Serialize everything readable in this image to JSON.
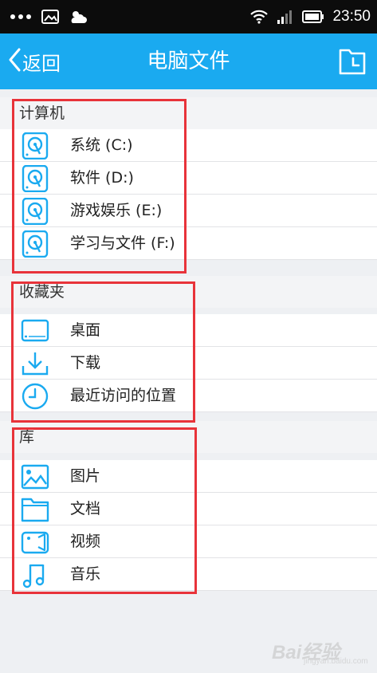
{
  "status_bar": {
    "time": "23:50",
    "icons": [
      "more-dots-icon",
      "image-icon",
      "weather-icon",
      "wifi-icon",
      "signal-icon",
      "battery-icon"
    ]
  },
  "header": {
    "back_label": "返回",
    "title": "电脑文件",
    "accent_color": "#1aaaf0"
  },
  "sections": {
    "computer": {
      "title": "计算机",
      "items": [
        {
          "label": "系统 (C:)",
          "icon": "drive-icon"
        },
        {
          "label": "软件 (D:)",
          "icon": "drive-icon"
        },
        {
          "label": "游戏娱乐 (E:)",
          "icon": "drive-icon"
        },
        {
          "label": "学习与文件 (F:)",
          "icon": "drive-icon"
        }
      ]
    },
    "favorites": {
      "title": "收藏夹",
      "items": [
        {
          "label": "桌面",
          "icon": "desktop-icon"
        },
        {
          "label": "下载",
          "icon": "download-icon"
        },
        {
          "label": "最近访问的位置",
          "icon": "clock-icon"
        }
      ]
    },
    "library": {
      "title": "库",
      "items": [
        {
          "label": "图片",
          "icon": "picture-icon"
        },
        {
          "label": "文档",
          "icon": "folder-icon"
        },
        {
          "label": "视频",
          "icon": "video-icon"
        },
        {
          "label": "音乐",
          "icon": "music-icon"
        }
      ]
    }
  },
  "watermark": {
    "brand": "Bai经验",
    "url": "jingyan.baidu.com"
  },
  "colors": {
    "icon": "#1aaaf0",
    "highlight": "#e8333a"
  }
}
